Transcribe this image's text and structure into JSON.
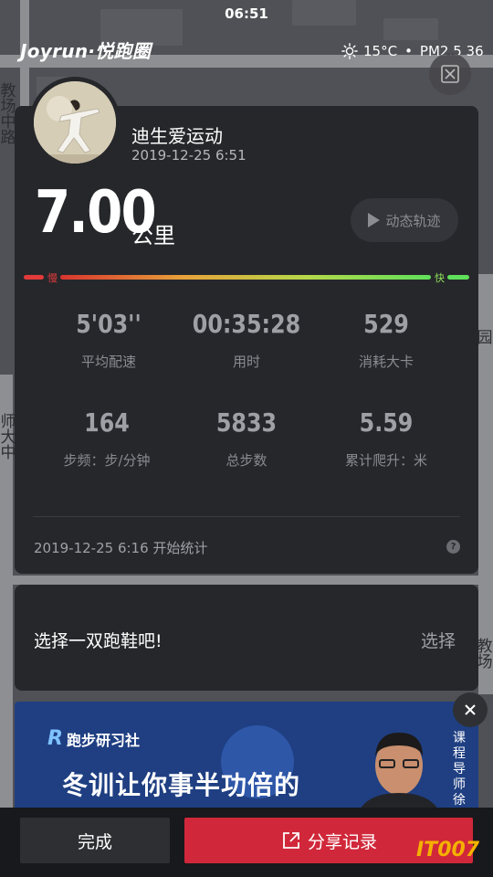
{
  "status_bar": {
    "time": "06:51"
  },
  "header": {
    "logo_text": "Joyrun·悦跑圈",
    "temperature": "15°C",
    "air_quality": "PM2.5 36"
  },
  "map": {
    "labels": [
      "教场中路",
      "师大中",
      "园",
      "教场"
    ]
  },
  "activity": {
    "username": "迪生爱运动",
    "datetime": "2019-12-25 6:51",
    "distance": "7.00",
    "distance_unit": "公里",
    "track_button": "动态轨迹",
    "speed_slow": "慢",
    "speed_fast": "快",
    "stats": [
      {
        "value": "5'03''",
        "label": "平均配速"
      },
      {
        "value": "00:35:28",
        "label": "用时"
      },
      {
        "value": "529",
        "label": "消耗大卡"
      },
      {
        "value": "164",
        "label": "步频：步/分钟"
      },
      {
        "value": "5833",
        "label": "总步数"
      },
      {
        "value": "5.59",
        "label": "累计爬升：米"
      }
    ],
    "start_text": "2019-12-25 6:16 开始统计",
    "help": "?"
  },
  "shoes": {
    "prompt": "选择一双跑鞋吧!",
    "select_label": "选择"
  },
  "ad": {
    "brand": "跑步研习社",
    "headline": "冬训让你事半功倍的",
    "side_text": "课程导师 徐"
  },
  "bottom": {
    "done_label": "完成",
    "share_label": "分享记录"
  },
  "watermark": "IT007",
  "colors": {
    "share_button": "#d0283a",
    "card_bg": "#26272b",
    "slow": "#e23a3a",
    "fast": "#5fe05a"
  }
}
